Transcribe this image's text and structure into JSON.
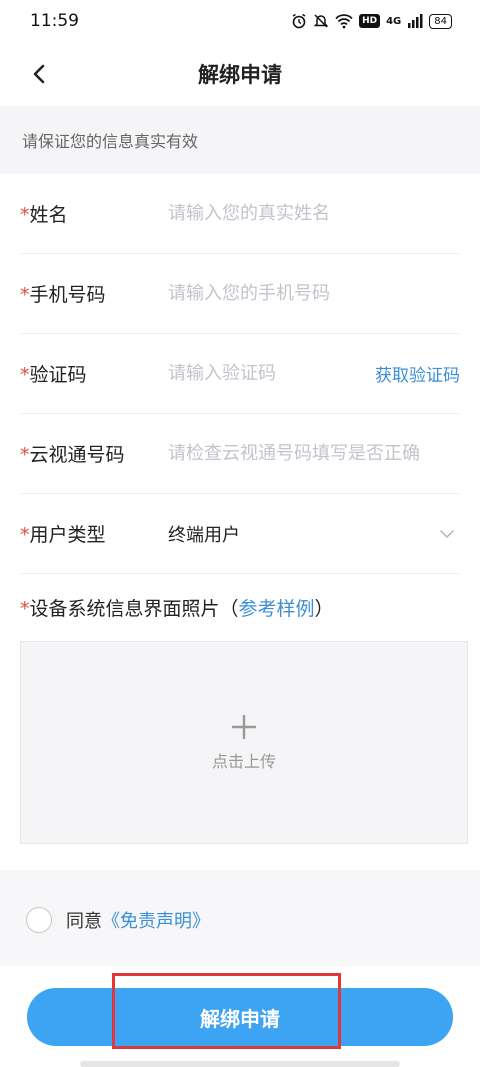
{
  "status_bar": {
    "time": "11:59",
    "network": "4G",
    "signal_label": "ıll",
    "hd_label": "HD",
    "battery": "84"
  },
  "nav": {
    "title": "解绑申请"
  },
  "notice": "请保证您的信息真实有效",
  "form": {
    "required_mark": "*",
    "name_label": "姓名",
    "name_placeholder": "请输入您的真实姓名",
    "phone_label": "手机号码",
    "phone_placeholder": "请输入您的手机号码",
    "code_label": "验证码",
    "code_placeholder": "请输入验证码",
    "code_button": "获取验证码",
    "number_label": "云视通号码",
    "number_placeholder": "请检查云视通号码填写是否正确",
    "user_type_label": "用户类型",
    "user_type_value": "终端用户",
    "photo_label": "设备系统信息界面照片（",
    "photo_link": "参考样例",
    "photo_label_end": "）",
    "upload_text": "点击上传"
  },
  "agree": {
    "text": "同意",
    "link": "《免责声明》"
  },
  "submit": {
    "label": "解绑申请"
  },
  "colors": {
    "accent": "#3da3f3",
    "link": "#3a8fd6",
    "required": "#e24b3b",
    "highlight": "#e0373d"
  }
}
